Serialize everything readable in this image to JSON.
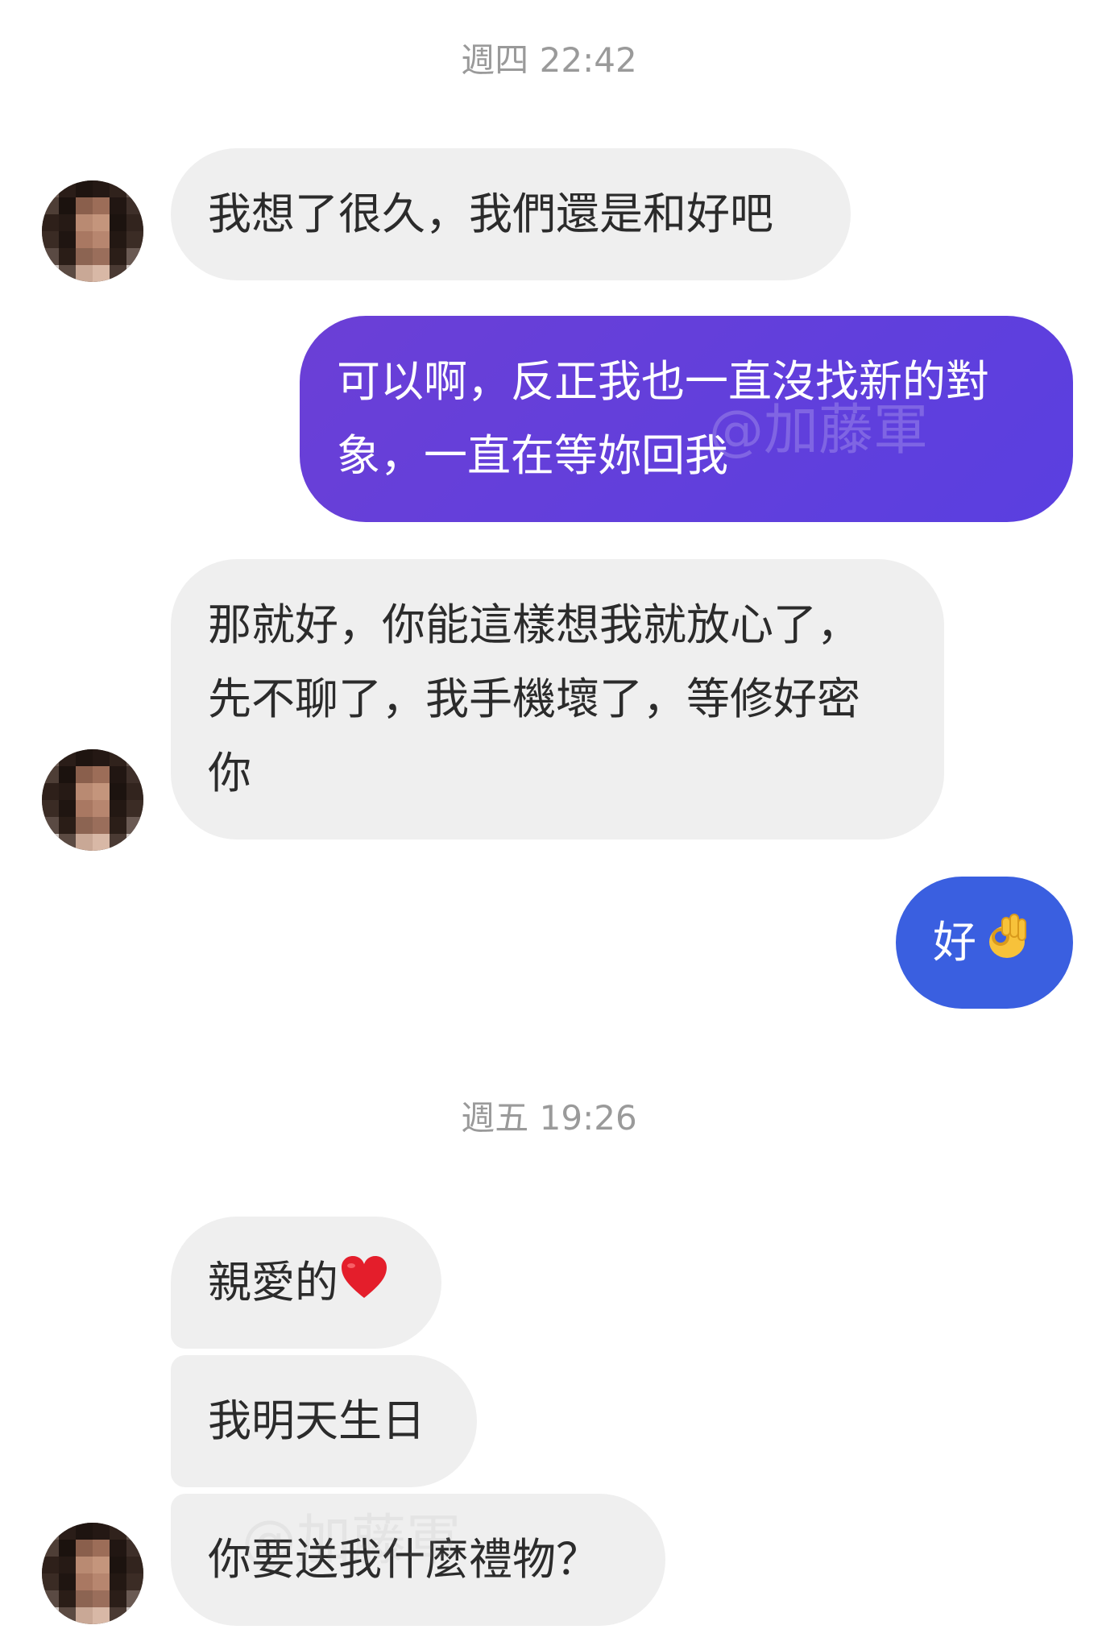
{
  "timestamps": {
    "first": "週四 22:42",
    "second": "週五 19:26"
  },
  "messages": [
    {
      "id": "m1",
      "sender": "contact",
      "lines": [
        "我想了很久，我們還是和好吧"
      ]
    },
    {
      "id": "m2",
      "sender": "me",
      "lines": [
        "可以啊，反正我也一直沒找新的對",
        "象，一直在等妳回我"
      ]
    },
    {
      "id": "m3",
      "sender": "contact",
      "lines": [
        "那就好，你能這樣想我就放心了，",
        "先不聊了，我手機壞了，等修好密",
        "你"
      ]
    },
    {
      "id": "m4",
      "sender": "me",
      "text": "好",
      "emoji": "ok-hand-emoji"
    },
    {
      "id": "m5",
      "sender": "contact",
      "text": "親愛的",
      "emoji": "red-heart-emoji"
    },
    {
      "id": "m6",
      "sender": "contact",
      "text": "我明天生日"
    },
    {
      "id": "m7",
      "sender": "contact",
      "text": "你要送我什麼禮物？"
    }
  ],
  "watermark": "@加藤軍",
  "colors": {
    "incoming_bubble": "#efefef",
    "outgoing_gradient_start": "#6b3fd6",
    "outgoing_gradient_end": "#5a3fe0",
    "outgoing_blue": "#3a5fe0",
    "timestamp_text": "#9a9a9a"
  }
}
